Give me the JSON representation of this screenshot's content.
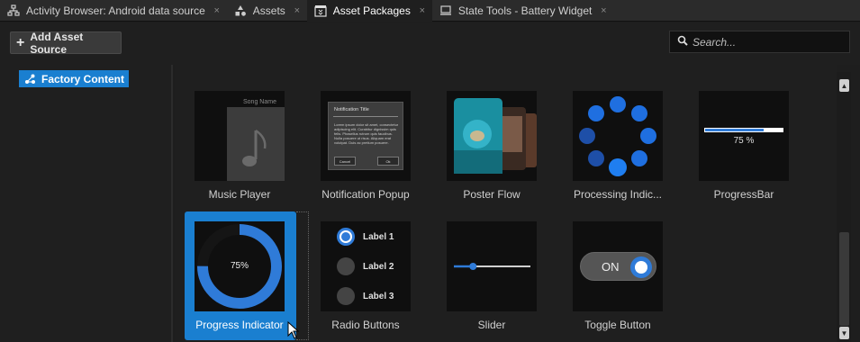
{
  "tabs": [
    {
      "label": "Activity Browser: Android data source",
      "icon": "activity-browser-icon",
      "active": false
    },
    {
      "label": "Assets",
      "icon": "assets-icon",
      "active": false
    },
    {
      "label": "Asset Packages",
      "icon": "asset-packages-icon",
      "active": true
    },
    {
      "label": "State Tools - Battery Widget",
      "icon": "monitor-icon",
      "active": false
    }
  ],
  "tab_close_glyph": "×",
  "toolbar": {
    "add_label": "Add Asset Source",
    "add_icon": "plus-icon",
    "search_placeholder": "Search..."
  },
  "tree": {
    "items": [
      {
        "label": "Factory Content",
        "icon": "factory-content-icon",
        "selected": true
      }
    ]
  },
  "packages": [
    {
      "label": "Music Player",
      "song_name": "Song Name"
    },
    {
      "label": "Notification Popup",
      "title": "Notification Title",
      "body": "Lorem ipsum dolor sit amet, consectetur adipiscing elit. Curabitur dignissim quis felis. Phasellus rutrum quis faucibus. Nulla posuere ut risus. Aliquam erat volutpat. Duis ac pretium posuere.",
      "cancel": "Cancel",
      "ok": "Ok"
    },
    {
      "label": "Poster Flow",
      "poster_title": "ISLAND DESTINATIONS",
      "poster_subtitle": "Island Destinations"
    },
    {
      "label": "Processing Indic..."
    },
    {
      "label": "ProgressBar",
      "value_text": "75 %",
      "value": 0.75
    },
    {
      "label": "Progress Indicator",
      "value_text": "75%",
      "value": 0.75,
      "selected": true
    },
    {
      "label": "Radio Buttons",
      "options": [
        "Label 1",
        "Label 2",
        "Label 3"
      ],
      "selected_index": 0
    },
    {
      "label": "Slider",
      "value": 0.25
    },
    {
      "label": "Toggle Button",
      "state_text": "ON"
    }
  ],
  "colors": {
    "accent": "#1a7fd0",
    "control_blue": "#2f7bd8",
    "background": "#1f1f1f",
    "tabbar": "#2b2b2b"
  },
  "scrollbar": {
    "up": "▲",
    "down": "▼"
  }
}
